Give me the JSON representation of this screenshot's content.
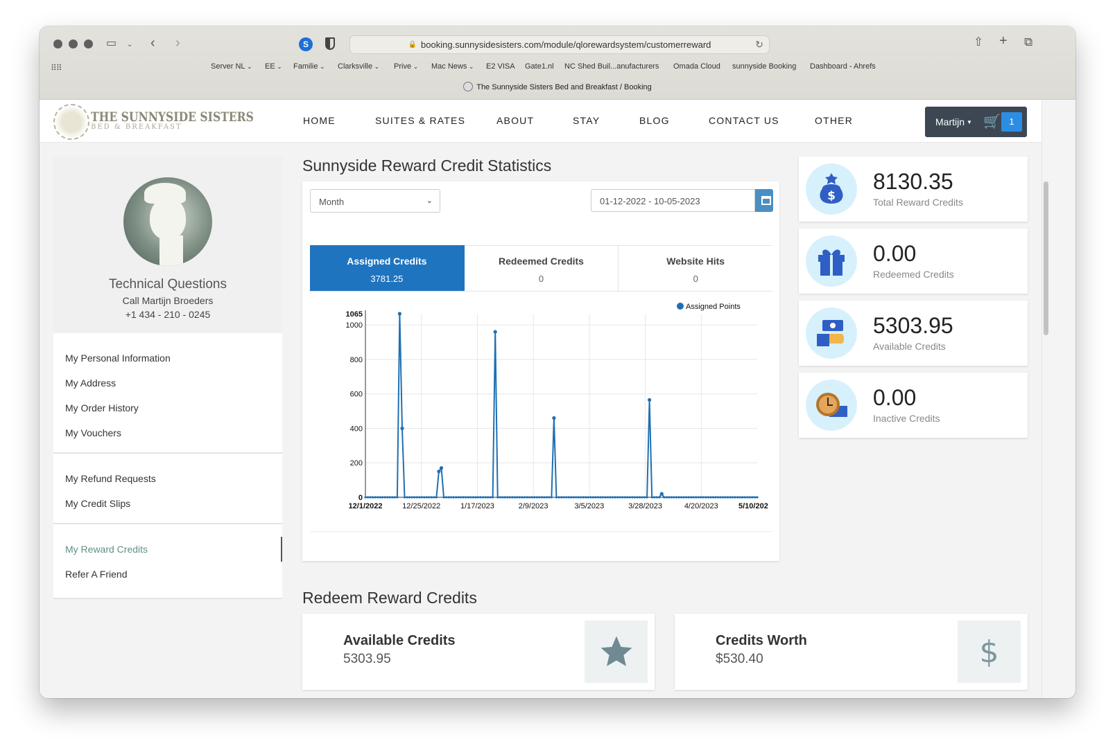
{
  "browser": {
    "url": "booking.sunnysidesisters.com/module/qlorewardsystem/customerreward",
    "tab_title": "The Sunnyside Sisters Bed and Breakfast / Booking",
    "bookmarks": [
      "Server NL",
      "EE",
      "Familie",
      "Clarksville",
      "Prive",
      "Mac News",
      "E2 VISA",
      "Gate1.nl",
      "NC Shed Buil...anufacturers",
      "Omada Cloud",
      "sunnyside Booking",
      "Dashboard - Ahrefs"
    ],
    "bookmark_dropdowns": [
      true,
      true,
      true,
      true,
      true,
      true,
      false,
      false,
      false,
      false,
      false,
      false
    ]
  },
  "site": {
    "logo_line1": "THE SUNNYSIDE SISTERS",
    "logo_line2": "BED & BREAKFAST",
    "nav": [
      "HOME",
      "SUITES & RATES",
      "ABOUT",
      "STAY",
      "BLOG",
      "CONTACT US",
      "OTHER"
    ],
    "user_name": "Martijn",
    "cart_count": "1"
  },
  "sidebar": {
    "title": "Technical Questions",
    "line2": "Call Martijn Broeders",
    "line3": "+1 434 - 210 - 0245",
    "groups": [
      [
        "My Personal Information",
        "My Address",
        "My Order History",
        "My Vouchers"
      ],
      [
        "My Refund Requests",
        "My Credit Slips"
      ],
      [
        "My Reward Credits",
        "Refer A Friend"
      ]
    ],
    "active_item": "My Reward Credits"
  },
  "stats": {
    "title": "Sunnyside Reward Credit Statistics",
    "period_select": "Month",
    "date_range": "01-12-2022 - 10-05-2023",
    "tabs": [
      {
        "label": "Assigned Credits",
        "value": "3781.25"
      },
      {
        "label": "Redeemed Credits",
        "value": "0"
      },
      {
        "label": "Website Hits",
        "value": "0"
      }
    ]
  },
  "chart_data": {
    "type": "line",
    "legend": "Assigned Points",
    "legend_position": "top-right",
    "color": "#1f6fb2",
    "x_ticks": [
      "12/1/2022",
      "12/25/2022",
      "1/17/2023",
      "2/9/2023",
      "3/5/2023",
      "3/28/2023",
      "4/20/2023",
      "5/10/202"
    ],
    "y_ticks": [
      0,
      200,
      400,
      600,
      800,
      1000,
      1065
    ],
    "ylim": [
      0,
      1065
    ],
    "xlim": [
      "2022-12-01",
      "2023-05-10"
    ],
    "grid": true,
    "spikes": [
      {
        "date": "2022-12-15",
        "value": 1065
      },
      {
        "date": "2022-12-16",
        "value": 400
      },
      {
        "date": "2022-12-31",
        "value": 150
      },
      {
        "date": "2023-01-01",
        "value": 170
      },
      {
        "date": "2023-01-23",
        "value": 960
      },
      {
        "date": "2023-02-16",
        "value": 460
      },
      {
        "date": "2023-03-27",
        "value": 565
      },
      {
        "date": "2023-04-01",
        "value": 20
      }
    ]
  },
  "summary_cards": [
    {
      "value": "8130.35",
      "label": "Total Reward Credits",
      "icon": "money-bag-icon"
    },
    {
      "value": "0.00",
      "label": "Redeemed Credits",
      "icon": "gift-icon"
    },
    {
      "value": "5303.95",
      "label": "Available Credits",
      "icon": "cash-hand-icon"
    },
    {
      "value": "0.00",
      "label": "Inactive Credits",
      "icon": "clock-money-icon"
    }
  ],
  "redeem": {
    "title": "Redeem Reward Credits",
    "available_label": "Available Credits",
    "available_value": "5303.95",
    "worth_label": "Credits Worth",
    "worth_value": "$530.40"
  }
}
